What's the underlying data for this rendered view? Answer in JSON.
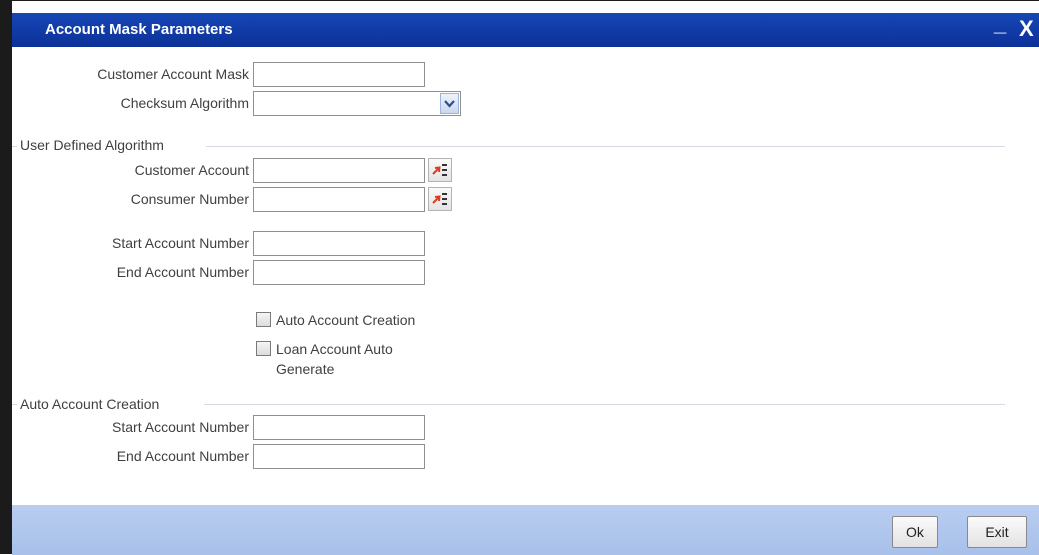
{
  "window": {
    "title": "Account Mask Parameters",
    "minimize_glyph": "_",
    "close_glyph": "X"
  },
  "fields": {
    "customer_account_mask": {
      "label": "Customer Account Mask",
      "value": ""
    },
    "checksum_algorithm": {
      "label": "Checksum Algorithm",
      "value": ""
    }
  },
  "user_defined_algorithm": {
    "heading": "User Defined Algorithm",
    "customer_account": {
      "label": "Customer Account",
      "value": ""
    },
    "consumer_number": {
      "label": "Consumer Number",
      "value": ""
    },
    "start_account_number": {
      "label": "Start Account Number",
      "value": ""
    },
    "end_account_number": {
      "label": "End Account Number",
      "value": ""
    },
    "auto_account_creation": {
      "label": "Auto Account Creation",
      "checked": false
    },
    "loan_account_auto_generate": {
      "label_line1": "Loan Account Auto",
      "label_line2": "Generate",
      "checked": false
    }
  },
  "auto_account_creation": {
    "heading": "Auto Account Creation",
    "start_account_number": {
      "label": "Start Account Number",
      "value": ""
    },
    "end_account_number": {
      "label": "End Account Number",
      "value": ""
    }
  },
  "footer": {
    "ok_label": "Ok",
    "exit_label": "Exit"
  },
  "colors": {
    "titlebar": "#0f3aa3",
    "footer": "#b0c6ee",
    "lov_icon_accent": "#e03b1b"
  },
  "icons": {
    "lov_button": "list-of-values-icon",
    "dropdown_arrow": "chevron-down-icon"
  }
}
